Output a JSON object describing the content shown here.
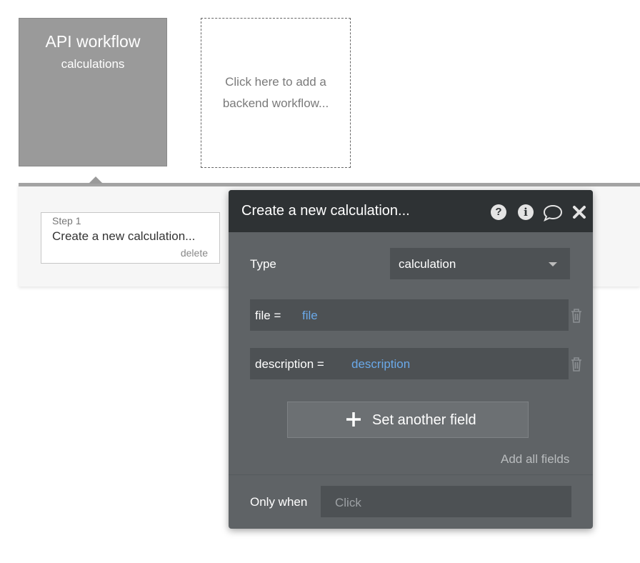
{
  "workflow_card": {
    "title": "API workflow",
    "subtitle": "calculations"
  },
  "add_card": {
    "text": "Click here to add a backend workflow..."
  },
  "step": {
    "number": "Step 1",
    "name": "Create a new calculation...",
    "delete_label": "delete"
  },
  "panel": {
    "title": "Create a new calculation...",
    "icons": [
      "help-icon",
      "info-icon",
      "comment-icon",
      "close-icon"
    ],
    "type_label": "Type",
    "type_value": "calculation",
    "fields": [
      {
        "key": "file =",
        "value": "file"
      },
      {
        "key": "description =",
        "value": "description"
      }
    ],
    "add_field_label": "Set another field",
    "add_all_label": "Add all fields",
    "only_when_label": "Only when",
    "only_when_placeholder": "Click"
  },
  "colors": {
    "panel_bg": "#5f6366",
    "header_bg": "#2e3234",
    "input_bg": "#4d5154",
    "value_text": "#6aa9e9",
    "card_bg": "#9a9a9a"
  }
}
